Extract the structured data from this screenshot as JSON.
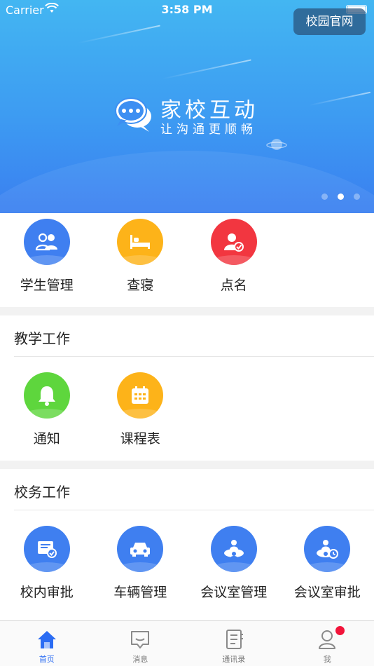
{
  "status_bar": {
    "carrier": "Carrier",
    "time": "3:58 PM"
  },
  "banner": {
    "site_button": "校园官网",
    "title": "家校互动",
    "subtitle": "让沟通更顺畅",
    "dots": 3,
    "active_dot": 2
  },
  "quick": {
    "items": [
      {
        "label": "学生管理",
        "icon": "students-icon",
        "color": "#3f7ff0"
      },
      {
        "label": "查寝",
        "icon": "bed-icon",
        "color": "#fdb319"
      },
      {
        "label": "点名",
        "icon": "roll-call-icon",
        "color": "#f23640"
      }
    ]
  },
  "teaching": {
    "title": "教学工作",
    "items": [
      {
        "label": "通知",
        "icon": "bell-icon",
        "color": "#5ed63d"
      },
      {
        "label": "课程表",
        "icon": "calendar-icon",
        "color": "#fdb319"
      }
    ]
  },
  "admin": {
    "title": "校务工作",
    "items": [
      {
        "label": "校内审批",
        "icon": "approval-icon",
        "color": "#3f7ff0"
      },
      {
        "label": "车辆管理",
        "icon": "car-icon",
        "color": "#3f7ff0"
      },
      {
        "label": "会议室管理",
        "icon": "meeting-room-icon",
        "color": "#3f7ff0"
      },
      {
        "label": "会议室审批",
        "icon": "meeting-approval-icon",
        "color": "#3f7ff0"
      }
    ]
  },
  "tabbar": {
    "tabs": [
      {
        "label": "首页",
        "icon": "home-icon",
        "active": true
      },
      {
        "label": "消息",
        "icon": "message-icon",
        "active": false
      },
      {
        "label": "通讯录",
        "icon": "contacts-icon",
        "active": false
      },
      {
        "label": "我",
        "icon": "profile-icon",
        "active": false,
        "badge": true
      }
    ]
  }
}
